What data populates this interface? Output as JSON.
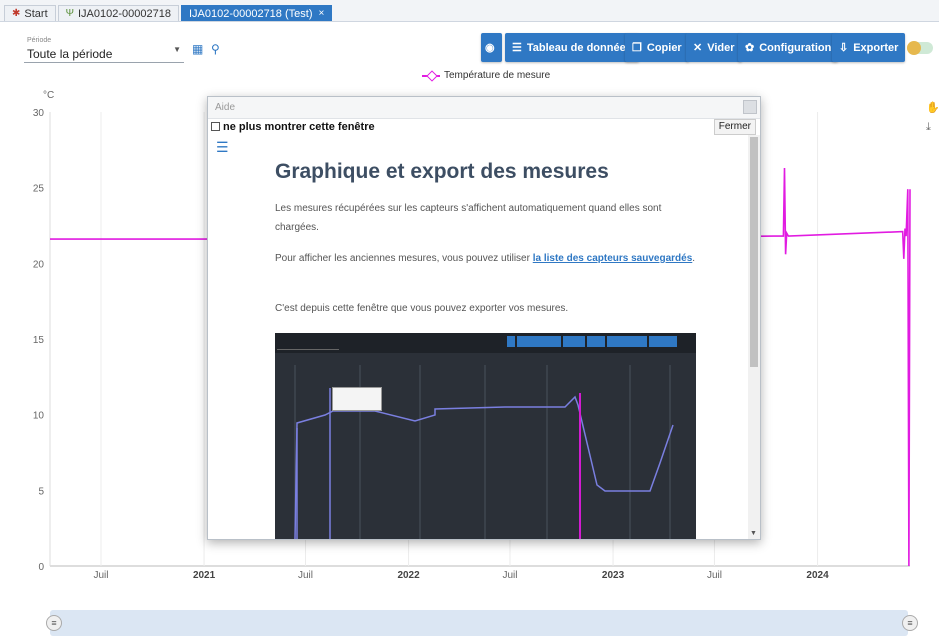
{
  "tabs": [
    {
      "label": "Start",
      "icon": "start-icon"
    },
    {
      "label": "IJA0102-00002718",
      "icon": "sensor-icon"
    },
    {
      "label": "IJA0102-00002718 (Test)",
      "icon": "close-icon",
      "active": true
    }
  ],
  "period": {
    "label": "Période",
    "value": "Toute la période"
  },
  "toolbar": {
    "eye_icon": "eye-icon",
    "table_label": "Tableau de données",
    "copy_label": "Copier",
    "clear_label": "Vider",
    "config_label": "Configuration",
    "export_label": "Exporter"
  },
  "legend": {
    "series_label": "Température de mesure"
  },
  "colors": {
    "accent": "#2f78c4",
    "series": "#e11be1"
  },
  "chart_data": {
    "type": "line",
    "ylabel": "°C",
    "ylim": [
      0,
      30
    ],
    "yticks": [
      "0",
      "5",
      "10",
      "15",
      "20",
      "25",
      "30"
    ],
    "xticks": [
      "Juil",
      "2021",
      "Juil",
      "2022",
      "Juil",
      "2023",
      "Juil",
      "2024"
    ],
    "grid": true,
    "series": [
      {
        "name": "Température de mesure",
        "x": [
          "2020-04-01",
          "2020-07-01",
          "2021-01-01",
          "2023-10-15",
          "2023-11-01",
          "2023-11-03",
          "2023-11-05",
          "2023-11-07",
          "2023-11-10",
          "2024-06-01",
          "2024-06-03",
          "2024-06-05",
          "2024-06-07",
          "2024-06-10",
          "2024-06-12",
          "2024-06-14"
        ],
        "values": [
          21.6,
          21.6,
          21.6,
          21.8,
          21.8,
          26.3,
          20.6,
          22.0,
          21.8,
          22.1,
          20.3,
          22.3,
          21.8,
          24.9,
          0.0,
          24.9
        ]
      }
    ]
  },
  "dialog": {
    "title": "Aide",
    "dont_show_label": "ne plus montrer cette fenêtre",
    "close_label": "Fermer",
    "heading": "Graphique et export des mesures",
    "p1": "Les mesures récupérées sur les capteurs s'affichent automatiquement quand elles sont chargées.",
    "p2_before": "Pour afficher les anciennes mesures, vous pouvez utiliser ",
    "p2_link": "la liste des capteurs sauvegardés",
    "p2_after": ".",
    "p3": "C'est depuis cette fenêtre que vous pouvez exporter vos mesures."
  }
}
